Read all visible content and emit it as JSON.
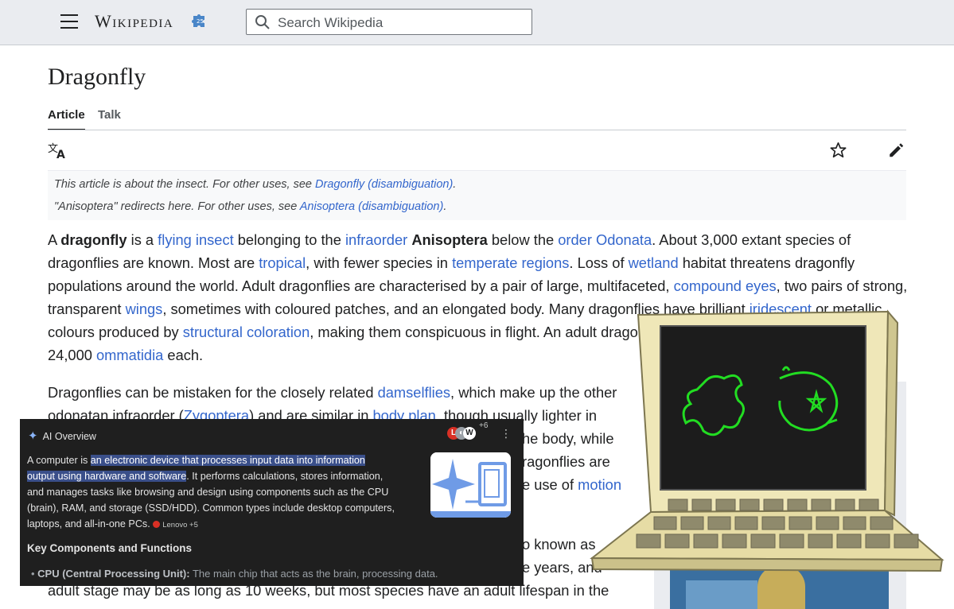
{
  "header": {
    "wordmark": "Wikipedia",
    "search_placeholder": "Search Wikipedia"
  },
  "page": {
    "title": "Dragonfly",
    "tabs": [
      "Article",
      "Talk"
    ]
  },
  "hatnote": {
    "line1_prefix": "This article is about the insect. For other uses, see ",
    "line1_link": "Dragonfly (disambiguation)",
    "line1_suffix": ".",
    "line2_prefix": "\"Anisoptera\" redirects here. For other uses, see ",
    "line2_link": "Anisoptera (disambiguation)",
    "line2_suffix": "."
  },
  "lead": {
    "l1": {
      "t1": "A ",
      "b1": "dragonfly",
      "t2": " is a ",
      "a1": "flying insect",
      "t3": " belonging to the ",
      "a2": "infraorder",
      "t4": " ",
      "b2": "Anisoptera",
      "t5": " below the ",
      "a3": "order Odonata",
      "t6": ". About 3,000 extant species of"
    },
    "l2": {
      "t1": "dragonflies are known. Most are ",
      "a1": "tropical",
      "t2": ", with fewer species in ",
      "a2": "temperate regions",
      "t3": ". Loss of ",
      "a3": "wetland",
      "t4": " habitat threatens dragonfly"
    },
    "l3": {
      "t1": "populations around the world. Adult dragonflies are characterised by a pair of large, multifaceted, ",
      "a1": "compound eyes",
      "t2": ", two pairs of strong,"
    },
    "l4": {
      "t1": "transparent ",
      "a1": "wings",
      "t2": ", sometimes with coloured patches, and an elongated body. Many dragonflies have brilliant ",
      "a2": "iridescent",
      "t3": " or metallic"
    },
    "l5": {
      "t1": "colours produced by ",
      "a1": "structural coloration",
      "t2": ", making them conspicuous in flight. An adult drago"
    },
    "l6": {
      "t1": "24,000 ",
      "a1": "ommatidia",
      "t2": " each."
    }
  },
  "para2": {
    "l1": {
      "t1": "Dragonflies can be mistaken for the closely related ",
      "a1": "damselflies",
      "t2": ", which make up the other"
    },
    "l2": {
      "t1": "odonatan infraorder (",
      "a1": "Zygoptera",
      "t2": ") and are similar in ",
      "a2": "body plan",
      "t3": ", though usually lighter in"
    },
    "l3": {
      "t1": "he body, while"
    },
    "l4": {
      "t1": "ragonflies are"
    },
    "l5": {
      "t1": "e use of ",
      "a1": "motion"
    }
  },
  "para3": {
    "l1": {
      "t1": "o known as"
    },
    "l2": {
      "t1": "e years, and"
    },
    "l3": {
      "t1": "adult stage may be as long as 10 weeks, but most species have an adult lifespan in the"
    }
  },
  "ai_overview": {
    "label": "AI Overview",
    "avatar_count": "+6",
    "intro": "A computer is ",
    "highlight_1": "an electronic device that processes input data into information",
    "highlight_2": "output using hardware and software",
    "rest_1": ". It performs calculations, stores information,",
    "rest_2": "and manages tasks like browsing and design using components such as the CPU",
    "rest_3": "(brain), RAM, and storage (SSD/HDD). Common types include desktop computers,",
    "rest_4": "laptops, and all-in-one PCs.",
    "source_chip": "Lenovo +5",
    "section_title": "Key Components and Functions",
    "bullet_bold": "CPU (Central Processing Unit):",
    "bullet_text": " The main chip that acts as the brain, processing data."
  },
  "colors": {
    "link": "#3366cc",
    "header_bg": "#eaecf0",
    "ai_bg": "#1f1f1f",
    "ai_highlight": "#3a4f8a",
    "screen_green": "#22dd22"
  },
  "icons": [
    "menu-icon",
    "wikipedia-globe-icon",
    "search-icon",
    "language-icon",
    "star-icon",
    "edit-pencil-icon",
    "sparkle-icon",
    "more-vert-icon"
  ]
}
